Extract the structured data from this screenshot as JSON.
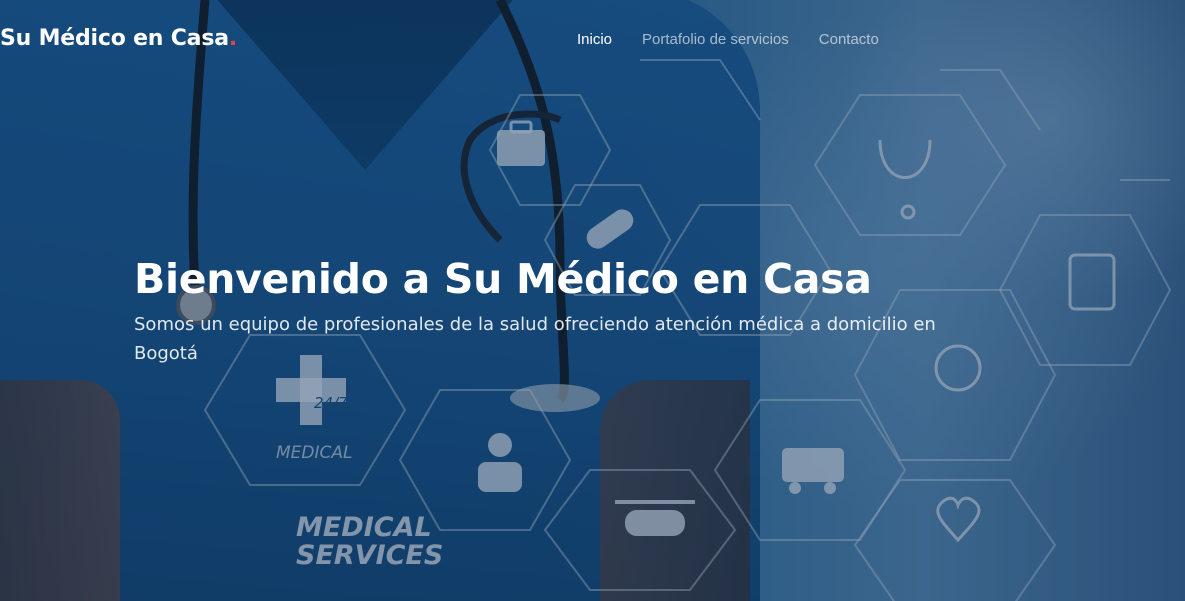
{
  "brand": {
    "name": "Su Médico en Casa",
    "dot": "."
  },
  "nav": {
    "items": [
      {
        "label": "Inicio",
        "active": true
      },
      {
        "label": "Portafolio de servicios",
        "active": false
      },
      {
        "label": "Contacto",
        "active": false
      }
    ]
  },
  "hero": {
    "title": "Bienvenido a Su Médico en Casa",
    "subtitle": "Somos un equipo de profesionales de la salud ofreciendo atención médica a domicilio en Bogotá"
  },
  "background": {
    "badge_24_7": "24/7",
    "badge_medical": "MEDICAL",
    "services_line1": "MEDICAL",
    "services_line2": "SERVICES"
  },
  "colors": {
    "brand_dot": "#e8443a",
    "nav_active": "#ffffff",
    "nav_inactive": "rgba(255,255,255,0.62)",
    "hero_bg": "#1a5a93"
  }
}
